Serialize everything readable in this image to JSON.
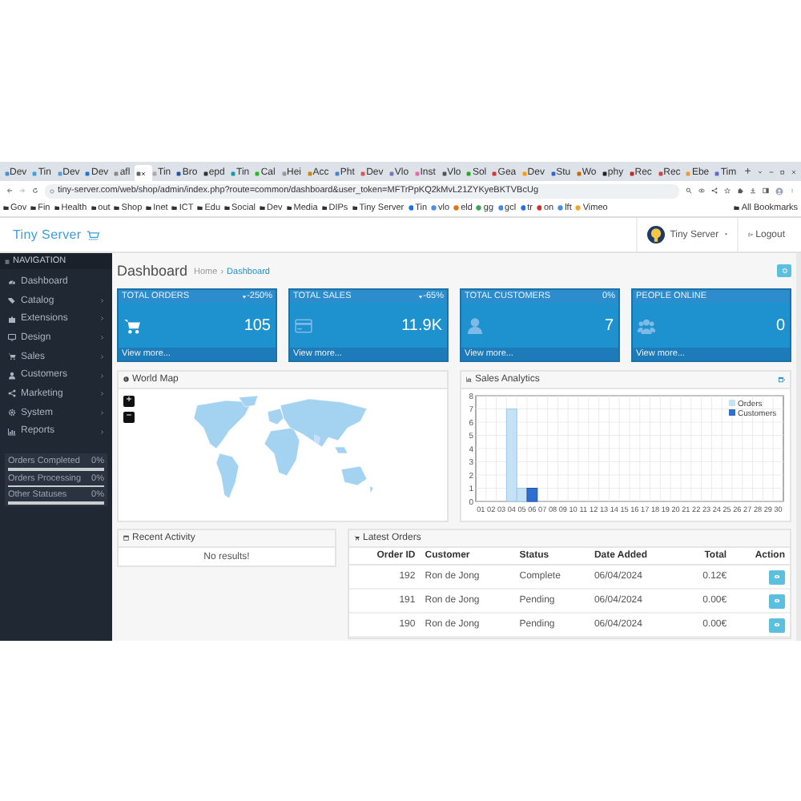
{
  "browser": {
    "tabs": [
      {
        "label": "Dev",
        "selected": false
      },
      {
        "label": "Tin",
        "selected": false
      },
      {
        "label": "Dev",
        "selected": false
      },
      {
        "label": "Dev",
        "selected": false
      },
      {
        "label": "afl",
        "selected": false
      },
      {
        "selected": true
      },
      {
        "label": "Tin",
        "selected": false
      },
      {
        "label": "Bro",
        "selected": false
      },
      {
        "label": "epd",
        "selected": false
      },
      {
        "label": "Tin",
        "selected": false
      },
      {
        "label": "Cal",
        "selected": false
      },
      {
        "label": "Hei",
        "selected": false
      },
      {
        "label": "Acc",
        "selected": false
      },
      {
        "label": "Pht",
        "selected": false
      },
      {
        "label": "Dev",
        "selected": false
      },
      {
        "label": "Vlo",
        "selected": false
      },
      {
        "label": "Inst",
        "selected": false
      },
      {
        "label": "Vlo",
        "selected": false
      },
      {
        "label": "Sol",
        "selected": false
      },
      {
        "label": "Gea",
        "selected": false
      },
      {
        "label": "Dev",
        "selected": false
      },
      {
        "label": "Stu",
        "selected": false
      },
      {
        "label": "Wo",
        "selected": false
      },
      {
        "label": "phy",
        "selected": false
      },
      {
        "label": "Rec",
        "selected": false
      },
      {
        "label": "Rec",
        "selected": false
      },
      {
        "label": "Ebe",
        "selected": false
      },
      {
        "label": "Tim",
        "selected": false
      }
    ],
    "new_tab": "+",
    "address": "tiny-server.com/web/shop/admin/index.php?route=common/dashboard&user_token=MFTrPpKQ2kMvL21ZYKyeBKTVBcUg",
    "bookmarks": [
      {
        "kind": "folder",
        "label": "Gov"
      },
      {
        "kind": "folder",
        "label": "Fin"
      },
      {
        "kind": "folder",
        "label": "Health"
      },
      {
        "kind": "folder",
        "label": "out"
      },
      {
        "kind": "folder",
        "label": "Shop"
      },
      {
        "kind": "folder",
        "label": "Inet"
      },
      {
        "kind": "folder",
        "label": "ICT"
      },
      {
        "kind": "folder",
        "label": "Edu"
      },
      {
        "kind": "folder",
        "label": "Social"
      },
      {
        "kind": "folder",
        "label": "Dev"
      },
      {
        "kind": "folder",
        "label": "Media"
      },
      {
        "kind": "folder",
        "label": "DIPs"
      },
      {
        "kind": "folder",
        "label": "Tiny Server"
      },
      {
        "kind": "site",
        "label": "Tin"
      },
      {
        "kind": "site",
        "label": "vlo"
      },
      {
        "kind": "site",
        "label": "eld"
      },
      {
        "kind": "site",
        "label": "gg"
      },
      {
        "kind": "site",
        "label": "gcl"
      },
      {
        "kind": "site",
        "label": "tr"
      },
      {
        "kind": "site",
        "label": "on"
      },
      {
        "kind": "site",
        "label": "lft"
      },
      {
        "kind": "site",
        "label": "Vimeo"
      }
    ],
    "all_bookmarks": "All Bookmarks"
  },
  "header": {
    "logo": "Tiny Server",
    "user": "Tiny Server",
    "logout": "Logout"
  },
  "sidebar": {
    "heading": "NAVIGATION",
    "items": [
      {
        "label": "Dashboard",
        "has_children": false
      },
      {
        "label": "Catalog",
        "has_children": true
      },
      {
        "label": "Extensions",
        "has_children": true
      },
      {
        "label": "Design",
        "has_children": true
      },
      {
        "label": "Sales",
        "has_children": true
      },
      {
        "label": "Customers",
        "has_children": true
      },
      {
        "label": "Marketing",
        "has_children": true
      },
      {
        "label": "System",
        "has_children": true
      },
      {
        "label": "Reports",
        "has_children": true
      }
    ],
    "progress": [
      {
        "label": "Orders Completed",
        "reading": "0%",
        "level": 0
      },
      {
        "label": "Orders Processing",
        "reading": "0%",
        "level": 0
      },
      {
        "label": "Other Statuses",
        "reading": "0%",
        "level": 0
      }
    ]
  },
  "page": {
    "title": "Dashboard",
    "separator": "›",
    "breadcrumb": [
      {
        "label": "Home",
        "current": false
      },
      {
        "label": "Dashboard",
        "current": true
      }
    ]
  },
  "stats": [
    {
      "title": "TOTAL ORDERS",
      "change": "-250%",
      "falling": true,
      "value": "105",
      "link": "View more..."
    },
    {
      "title": "TOTAL SALES",
      "change": "-65%",
      "falling": true,
      "value": "11.9K",
      "link": "View more..."
    },
    {
      "title": "TOTAL CUSTOMERS",
      "change": "0%",
      "falling": false,
      "value": "7",
      "link": "View more..."
    },
    {
      "title": "PEOPLE ONLINE",
      "value": "0",
      "link": "View more..."
    }
  ],
  "world_map": {
    "title": "World Map",
    "zoom_in": "+",
    "zoom_out": "−"
  },
  "sales_analytics": {
    "title": "Sales Analytics",
    "chart_data": {
      "type": "bar",
      "categories": [
        "01",
        "02",
        "03",
        "04",
        "05",
        "06",
        "07",
        "08",
        "09",
        "10",
        "11",
        "12",
        "13",
        "14",
        "15",
        "16",
        "17",
        "18",
        "19",
        "20",
        "21",
        "22",
        "23",
        "24",
        "25",
        "26",
        "27",
        "28",
        "29",
        "30"
      ],
      "series": [
        {
          "name": "Orders",
          "color": "#c4e1f5",
          "values": [
            0,
            0,
            0,
            7,
            1,
            0,
            0,
            0,
            0,
            0,
            0,
            0,
            0,
            0,
            0,
            0,
            0,
            0,
            0,
            0,
            0,
            0,
            0,
            0,
            0,
            0,
            0,
            0,
            0,
            0
          ]
        },
        {
          "name": "Customers",
          "color": "#2f6fce",
          "values": [
            0,
            0,
            0,
            0,
            0,
            1,
            0,
            0,
            0,
            0,
            0,
            0,
            0,
            0,
            0,
            0,
            0,
            0,
            0,
            0,
            0,
            0,
            0,
            0,
            0,
            0,
            0,
            0,
            0,
            0
          ]
        }
      ],
      "ylim": [
        0,
        8
      ],
      "yticks": [
        0,
        1,
        2,
        3,
        4,
        5,
        6,
        7,
        8
      ],
      "grid": true,
      "legend": true
    }
  },
  "recent_activity": {
    "title": "Recent Activity",
    "empty": "No results!"
  },
  "latest_orders": {
    "title": "Latest Orders",
    "columns": [
      "Order ID",
      "Customer",
      "Status",
      "Date Added",
      "Total",
      "Action"
    ],
    "rows": [
      {
        "id": "192",
        "customer": "Ron de Jong",
        "status": "Complete",
        "date": "06/04/2024",
        "total": "0.12€"
      },
      {
        "id": "191",
        "customer": "Ron de Jong",
        "status": "Pending",
        "date": "06/04/2024",
        "total": "0.00€"
      },
      {
        "id": "190",
        "customer": "Ron de Jong",
        "status": "Pending",
        "date": "06/04/2024",
        "total": "0.00€"
      }
    ]
  }
}
